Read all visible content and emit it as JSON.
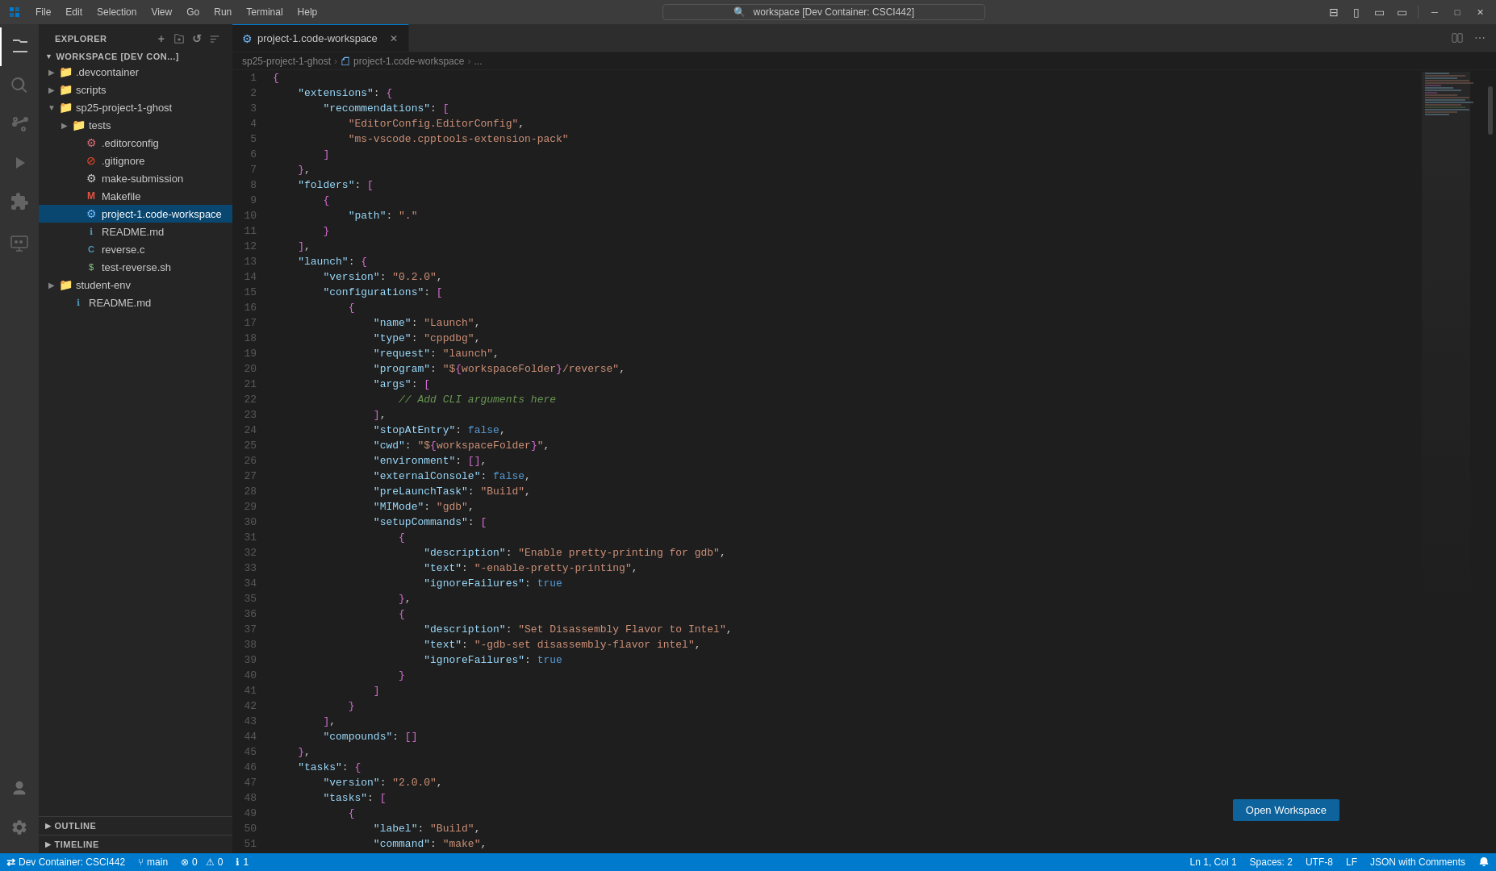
{
  "titleBar": {
    "appIcon": "◧",
    "menuItems": [
      "File",
      "Edit",
      "Selection",
      "View",
      "Go",
      "Run",
      "Terminal",
      "Help"
    ],
    "searchText": "workspace [Dev Container: CSCI442]",
    "windowControls": {
      "minimize": "─",
      "maximize": "□",
      "close": "✕"
    },
    "layoutBtns": [
      "⊞",
      "▱",
      "▭",
      "▭"
    ]
  },
  "activityBar": {
    "items": [
      {
        "name": "explorer",
        "icon": "📄",
        "active": true
      },
      {
        "name": "search",
        "icon": "🔍",
        "active": false
      },
      {
        "name": "source-control",
        "icon": "⑂",
        "active": false
      },
      {
        "name": "run-debug",
        "icon": "▶",
        "active": false
      },
      {
        "name": "extensions",
        "icon": "⊞",
        "active": false
      },
      {
        "name": "remote-explorer",
        "icon": "🖥",
        "active": false
      }
    ],
    "bottomItems": [
      {
        "name": "accounts",
        "icon": "👤"
      },
      {
        "name": "settings",
        "icon": "⚙"
      }
    ]
  },
  "sidebar": {
    "title": "EXPLORER",
    "headerActions": [
      "+",
      "⊟",
      "↺",
      "⋯"
    ],
    "workspaceLabel": "WORKSPACE [DEV CON...]",
    "tree": [
      {
        "level": 1,
        "type": "folder",
        "name": ".devcontainer",
        "expanded": false,
        "indent": 8
      },
      {
        "level": 1,
        "type": "folder",
        "name": "scripts",
        "expanded": false,
        "indent": 8
      },
      {
        "level": 1,
        "type": "folder",
        "name": "sp25-project-1-ghost",
        "expanded": true,
        "indent": 8
      },
      {
        "level": 2,
        "type": "folder",
        "name": "tests",
        "expanded": false,
        "indent": 24
      },
      {
        "level": 2,
        "type": "file",
        "name": ".editorconfig",
        "fileType": "config",
        "indent": 24
      },
      {
        "level": 2,
        "type": "file",
        "name": ".gitignore",
        "fileType": "git",
        "indent": 24
      },
      {
        "level": 2,
        "type": "file",
        "name": "make-submission",
        "fileType": "script",
        "indent": 24
      },
      {
        "level": 2,
        "type": "file",
        "name": "Makefile",
        "fileType": "makefile",
        "indent": 24
      },
      {
        "level": 2,
        "type": "file",
        "name": "project-1.code-workspace",
        "fileType": "workspace",
        "active": true,
        "indent": 24
      },
      {
        "level": 2,
        "type": "file",
        "name": "README.md",
        "fileType": "markdown",
        "indent": 24
      },
      {
        "level": 2,
        "type": "file",
        "name": "reverse.c",
        "fileType": "c",
        "indent": 24
      },
      {
        "level": 2,
        "type": "file",
        "name": "test-reverse.sh",
        "fileType": "shell",
        "indent": 24
      },
      {
        "level": 1,
        "type": "folder",
        "name": "student-env",
        "expanded": false,
        "indent": 8
      },
      {
        "level": 1,
        "type": "file",
        "name": "README.md",
        "fileType": "markdown",
        "indent": 8
      }
    ],
    "panels": [
      {
        "name": "OUTLINE",
        "expanded": false
      },
      {
        "name": "TIMELINE",
        "expanded": false
      }
    ]
  },
  "tabs": [
    {
      "name": "project-1.code-workspace",
      "icon": "⚙",
      "active": true,
      "modified": false
    }
  ],
  "breadcrumb": {
    "parts": [
      "sp25-project-1-ghost",
      "project-1.code-workspace",
      "..."
    ]
  },
  "editor": {
    "filename": "project-1.code-workspace",
    "language": "JSON with Comments",
    "lines": [
      {
        "num": 1,
        "content": "{"
      },
      {
        "num": 2,
        "content": "    \"extensions\": {"
      },
      {
        "num": 3,
        "content": "        \"recommendations\": ["
      },
      {
        "num": 4,
        "content": "            \"EditorConfig.EditorConfig\","
      },
      {
        "num": 5,
        "content": "            \"ms-vscode.cpptools-extension-pack\""
      },
      {
        "num": 6,
        "content": "        ]"
      },
      {
        "num": 7,
        "content": "    },"
      },
      {
        "num": 8,
        "content": "    \"folders\": ["
      },
      {
        "num": 9,
        "content": "        {"
      },
      {
        "num": 10,
        "content": "            \"path\": \".\""
      },
      {
        "num": 11,
        "content": "        }"
      },
      {
        "num": 12,
        "content": "    ],"
      },
      {
        "num": 13,
        "content": "    \"launch\": {"
      },
      {
        "num": 14,
        "content": "        \"version\": \"0.2.0\","
      },
      {
        "num": 15,
        "content": "        \"configurations\": ["
      },
      {
        "num": 16,
        "content": "            {"
      },
      {
        "num": 17,
        "content": "                \"name\": \"Launch\","
      },
      {
        "num": 18,
        "content": "                \"type\": \"cppdbg\","
      },
      {
        "num": 19,
        "content": "                \"request\": \"launch\","
      },
      {
        "num": 20,
        "content": "                \"program\": \"${workspaceFolder}/reverse\","
      },
      {
        "num": 21,
        "content": "                \"args\": ["
      },
      {
        "num": 22,
        "content": "                    // Add CLI arguments here"
      },
      {
        "num": 23,
        "content": "                ],"
      },
      {
        "num": 24,
        "content": "                \"stopAtEntry\": false,"
      },
      {
        "num": 25,
        "content": "                \"cwd\": \"${workspaceFolder}\","
      },
      {
        "num": 26,
        "content": "                \"environment\": [],"
      },
      {
        "num": 27,
        "content": "                \"externalConsole\": false,"
      },
      {
        "num": 28,
        "content": "                \"preLaunchTask\": \"Build\","
      },
      {
        "num": 29,
        "content": "                \"MIMode\": \"gdb\","
      },
      {
        "num": 30,
        "content": "                \"setupCommands\": ["
      },
      {
        "num": 31,
        "content": "                    {"
      },
      {
        "num": 32,
        "content": "                        \"description\": \"Enable pretty-printing for gdb\","
      },
      {
        "num": 33,
        "content": "                        \"text\": \"-enable-pretty-printing\","
      },
      {
        "num": 34,
        "content": "                        \"ignoreFailures\": true"
      },
      {
        "num": 35,
        "content": "                    },"
      },
      {
        "num": 36,
        "content": "                    {"
      },
      {
        "num": 37,
        "content": "                        \"description\": \"Set Disassembly Flavor to Intel\","
      },
      {
        "num": 38,
        "content": "                        \"text\": \"-gdb-set disassembly-flavor intel\","
      },
      {
        "num": 39,
        "content": "                        \"ignoreFailures\": true"
      },
      {
        "num": 40,
        "content": "                    }"
      },
      {
        "num": 41,
        "content": "                ]"
      },
      {
        "num": 42,
        "content": "            }"
      },
      {
        "num": 43,
        "content": "        ],"
      },
      {
        "num": 44,
        "content": "        \"compounds\": []"
      },
      {
        "num": 45,
        "content": "    },"
      },
      {
        "num": 46,
        "content": "    \"tasks\": {"
      },
      {
        "num": 47,
        "content": "        \"version\": \"2.0.0\","
      },
      {
        "num": 48,
        "content": "        \"tasks\": ["
      },
      {
        "num": 49,
        "content": "            {"
      },
      {
        "num": 50,
        "content": "                \"label\": \"Build\","
      },
      {
        "num": 51,
        "content": "                \"command\": \"make\","
      }
    ]
  },
  "statusBar": {
    "left": [
      {
        "text": "Dev Container: CSCI442",
        "icon": "><",
        "type": "remote"
      },
      {
        "text": "main",
        "icon": "⑂"
      },
      {
        "text": "0 errors, 0 warnings",
        "icon": "⊗"
      },
      {
        "text": "1",
        "icon": "⚠"
      }
    ],
    "right": [
      {
        "text": "Ln 1, Col 1"
      },
      {
        "text": "Spaces: 2"
      },
      {
        "text": "UTF-8"
      },
      {
        "text": "LF"
      },
      {
        "text": "JSON with Comments"
      }
    ]
  },
  "openWorkspaceBtn": "Open Workspace"
}
